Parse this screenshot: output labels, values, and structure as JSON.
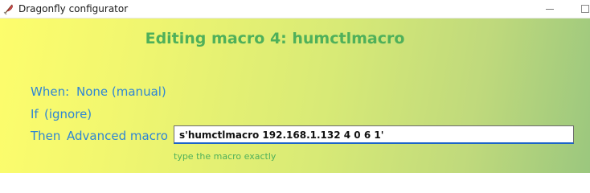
{
  "window": {
    "title": "Dragonfly configurator",
    "app_icon": "feather-pen-icon"
  },
  "heading": "Editing macro 4: humctlmacro",
  "when": {
    "label": "When:",
    "value": "None (manual)"
  },
  "if": {
    "label": "If",
    "value": "(ignore)"
  },
  "then": {
    "label": "Then",
    "value": "Advanced macro"
  },
  "macro_input": {
    "value": "s'humctlmacro 192.168.1.132 4 0 6 1'"
  },
  "hint": "type the macro exactly",
  "colors": {
    "heading": "#4fb05a",
    "label": "#2f86d4",
    "hint": "#4fb05a",
    "input_focus_border": "#1c64c8"
  }
}
